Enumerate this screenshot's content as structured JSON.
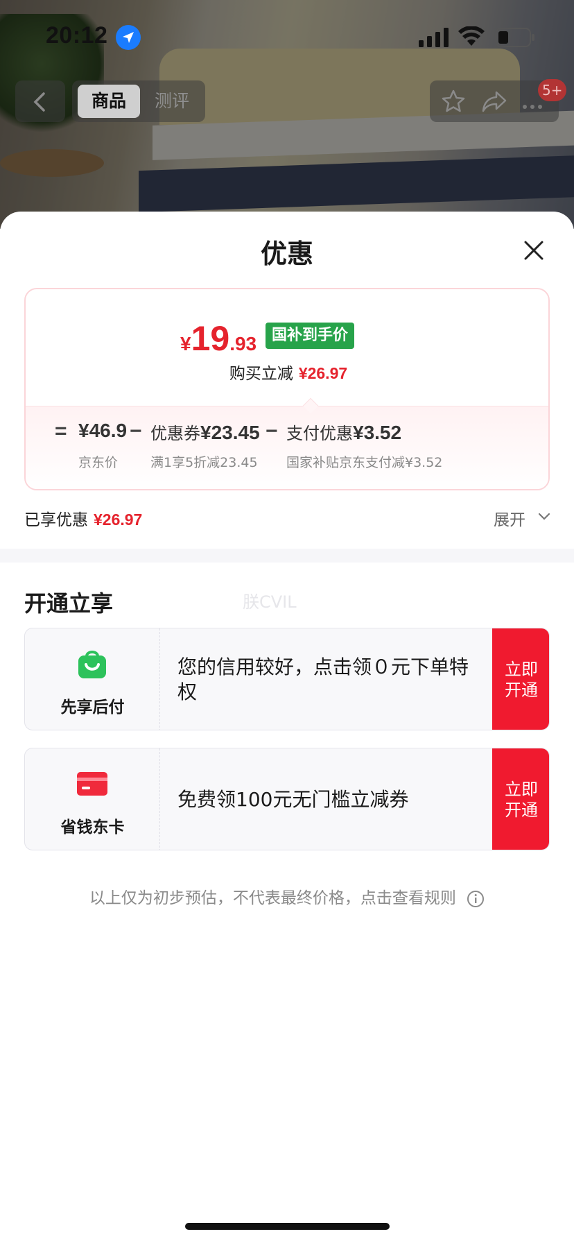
{
  "status_bar": {
    "time": "20:12"
  },
  "nav": {
    "tabs": [
      {
        "label": "商品",
        "active": true
      },
      {
        "label": "测评",
        "active": false
      }
    ],
    "badge": "5+"
  },
  "sheet": {
    "title": "优惠",
    "price": {
      "currency": "¥",
      "integer": "19",
      "decimal": ".93",
      "badge": "国补到手价",
      "instant_label": "购买立减",
      "instant_amount": "¥26.97"
    },
    "breakdown": {
      "eq": "=",
      "minus": "−",
      "jd_price": {
        "value": "¥46.9",
        "sub": "京东价"
      },
      "coupon": {
        "label": "优惠券",
        "value": "¥23.45",
        "sub": "满1享5折减23.45"
      },
      "payment": {
        "label": "支付优惠",
        "value": "¥3.52",
        "sub": "国家补贴京东支付减¥3.52"
      }
    },
    "enjoyed": {
      "label": "已享优惠",
      "amount": "¥26.97"
    },
    "expand_label": "展开",
    "section_title": "开通立享",
    "watermark": "朕CVIL",
    "offers": [
      {
        "name": "先享后付",
        "desc": "您的信用较好，点击领０元下单特权",
        "cta": "立即开通",
        "icon": "shopping-bag-icon",
        "icon_color": "#2dc25b"
      },
      {
        "name": "省钱东卡",
        "desc": "免费领100元无门槛立减券",
        "cta": "立即开通",
        "icon": "card-icon",
        "icon_color": "#f02a3c"
      }
    ],
    "note": "以上仅为初步预估，不代表最终价格，点击查看规则"
  },
  "colors": {
    "accent_red": "#e5232d",
    "cta_red": "#f01a2f",
    "gov_green": "#27a34a"
  }
}
